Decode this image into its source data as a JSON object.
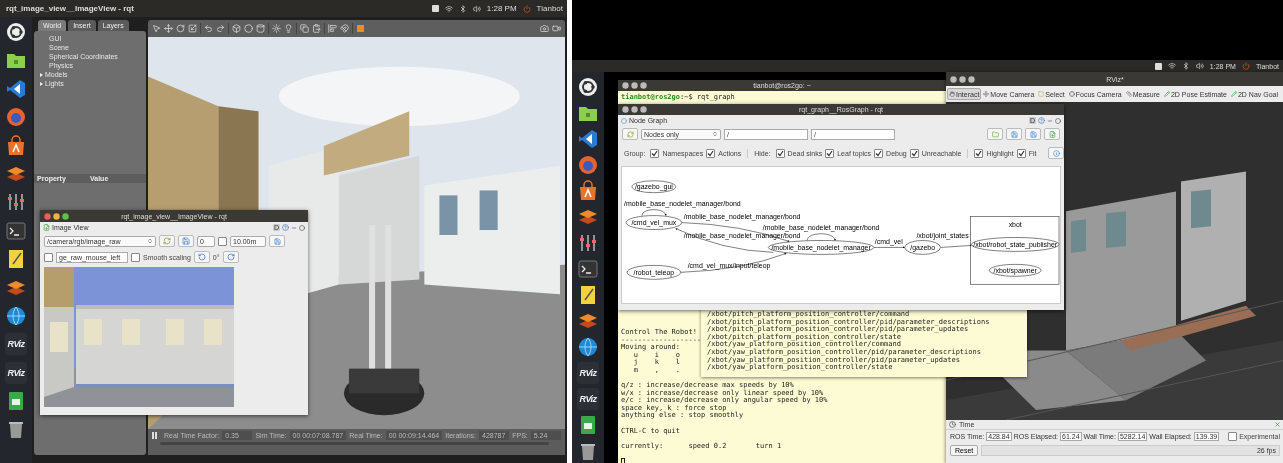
{
  "left": {
    "top_bar": {
      "title": "rqt_image_view__ImageView - rqt",
      "time": "1:28 PM",
      "user": "Tianbot"
    },
    "launcher": [
      {
        "kind": "ubuntu"
      },
      {
        "kind": "files"
      },
      {
        "kind": "vscode"
      },
      {
        "kind": "firefox"
      },
      {
        "kind": "software"
      },
      {
        "kind": "layers"
      },
      {
        "kind": "sliders"
      },
      {
        "kind": "terminal"
      },
      {
        "kind": "notes"
      },
      {
        "kind": "layers"
      },
      {
        "kind": "globe"
      },
      {
        "kind": "rviz",
        "label": "RViz"
      },
      {
        "kind": "rviz",
        "label": "RViz"
      },
      {
        "kind": "green"
      },
      {
        "kind": "trash"
      }
    ],
    "gazebo": {
      "tabs": [
        {
          "label": "World",
          "selected": true
        },
        {
          "label": "Insert",
          "selected": false
        },
        {
          "label": "Layers",
          "selected": false
        }
      ],
      "tree": [
        {
          "label": "GUI"
        },
        {
          "label": "Scene"
        },
        {
          "label": "Spherical Coordinates"
        },
        {
          "label": "Physics"
        },
        {
          "label": "Models",
          "expanded": false
        },
        {
          "label": "Lights",
          "expanded": false
        }
      ],
      "property_columns": [
        "Property",
        "Value"
      ],
      "status": [
        {
          "label": "Real Time Factor:",
          "value": "0.35"
        },
        {
          "label": "Sim Time:",
          "value": "00 00:07:08.787"
        },
        {
          "label": "Real Time:",
          "value": "00 00:09:14.464"
        },
        {
          "label": "Iterations:",
          "value": "428787"
        },
        {
          "label": "FPS:",
          "value": "5.24"
        }
      ]
    },
    "image_view": {
      "title": "rqt_image_view__ImageView - rqt",
      "plugin": "Image View",
      "dock": "D",
      "topic": "/camera/rgb/image_raw",
      "spin": "0",
      "range_checked": false,
      "range": "10.00m",
      "mouse_checked": false,
      "mouse_topic": "ge_raw_mouse_left",
      "smooth": {
        "label": "Smooth scaling",
        "checked": false
      },
      "rotation": "0°"
    }
  },
  "right": {
    "top_bar": {
      "time": "1:28 PM",
      "user": "Tianbot"
    },
    "launcher": [
      {
        "kind": "ubuntu"
      },
      {
        "kind": "files"
      },
      {
        "kind": "vscode"
      },
      {
        "kind": "firefox"
      },
      {
        "kind": "software"
      },
      {
        "kind": "layers"
      },
      {
        "kind": "sliders"
      },
      {
        "kind": "terminal"
      },
      {
        "kind": "notes"
      },
      {
        "kind": "layers"
      },
      {
        "kind": "globe"
      },
      {
        "kind": "rviz",
        "label": "RViz"
      },
      {
        "kind": "rviz",
        "label": "RViz"
      },
      {
        "kind": "green"
      },
      {
        "kind": "trash"
      }
    ],
    "terminal": {
      "title": "tianbot@ros2go: ~",
      "prompt_user": "tianbot@ros2go",
      "prompt_rest": ":~$ rqt_graph",
      "blocks": [
        [
          "Control The Robot!",
          "-------------------",
          "Moving around:",
          "   u    i    o",
          "   j    k    l",
          "   m    ,    ."
        ],
        [
          "q/z : increase/decrease max speeds by 10%",
          "w/x : increase/decrease only linear speed by 10%",
          "e/c : increase/decrease only angular speed by 10%",
          "space key, k : force stop",
          "anything else : stop smoothly"
        ],
        [
          "CTRL-C to quit"
        ],
        [
          "currently:      speed 0.2       turn 1"
        ]
      ],
      "topics": [
        "/xbot/pitch_platform_position_controller/command",
        "/xbot/pitch_platform_position_controller/pid/parameter_descriptions",
        "/xbot/pitch_platform_position_controller/pid/parameter_updates",
        "/xbot/pitch_platform_position_controller/state",
        "/xbot/yaw_platform_position_controller/command",
        "/xbot/yaw_platform_position_controller/pid/parameter_descriptions",
        "/xbot/yaw_platform_position_controller/pid/parameter_updates",
        "/xbot/yaw_platform_position_controller/state"
      ]
    },
    "rqt_graph": {
      "title": "rqt_graph__RosGraph - rqt",
      "plugin": "Node Graph",
      "dock": "D",
      "mode": "Nodes only",
      "filter_1": "/",
      "filter_2": "/",
      "groups": [
        {
          "label": "Group:",
          "checks": [
            {
              "label": "Namespaces",
              "checked": true
            },
            {
              "label": "Actions",
              "checked": true
            }
          ]
        },
        {
          "label": "Hide:",
          "checks": [
            {
              "label": "Dead sinks",
              "checked": true
            },
            {
              "label": "Leaf topics",
              "checked": true
            },
            {
              "label": "Debug",
              "checked": true
            },
            {
              "label": "Unreachable",
              "checked": true
            }
          ]
        },
        {
          "checks": [
            {
              "label": "Highlight",
              "checked": true
            },
            {
              "label": "Fit",
              "checked": true
            }
          ]
        }
      ],
      "graph": {
        "cluster": "xbot",
        "nodes": [
          "/gazebo_gui",
          "/cmd_vel_mux",
          "/robot_teleop",
          "/mobile_base_nodelet_manager",
          "/gazebo",
          "/xbot/robot_state_publisher",
          "/xbot/spawner"
        ],
        "edges": [
          {
            "label": "/mobile_base_nodelet_manager/bond"
          },
          {
            "label": "/mobile_base_nodelet_manager/bond"
          },
          {
            "label": "/mobile_base_nodelet_manager/bond"
          },
          {
            "label": "/mobile_base_nodelet_manager/bond"
          },
          {
            "label": "/cmd_vel_mux/input/teleop"
          },
          {
            "label": "/cmd_vel"
          },
          {
            "label": "/xbot/joint_states"
          }
        ]
      }
    },
    "rviz": {
      "title": "RViz*",
      "tools": [
        {
          "kind": "interact",
          "label": "Interact",
          "selected": true
        },
        {
          "kind": "move",
          "label": "Move Camera",
          "selected": false
        },
        {
          "kind": "select",
          "label": "Select",
          "selected": false
        },
        {
          "kind": "focus",
          "label": "Focus Camera",
          "selected": false
        },
        {
          "kind": "measure",
          "label": "Measure",
          "selected": false
        },
        {
          "kind": "pose",
          "label": "2D Pose Estimate",
          "selected": false
        },
        {
          "kind": "pose",
          "label": "2D Nav Goal",
          "selected": false
        }
      ],
      "time_panel": {
        "title": "Time",
        "fields": [
          {
            "label": "ROS Time:",
            "value": "428.84"
          },
          {
            "label": "ROS Elapsed:",
            "value": "61.24"
          },
          {
            "label": "Wall Time:",
            "value": "5282.14"
          },
          {
            "label": "Wall Elapsed:",
            "value": "139.39"
          }
        ],
        "experimental": {
          "label": "Experimental",
          "checked": false
        },
        "reset": "Reset",
        "fps": "26 fps"
      }
    }
  }
}
